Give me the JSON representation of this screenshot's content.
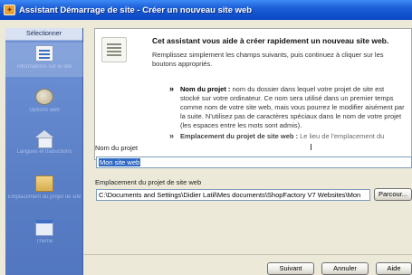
{
  "window": {
    "title": "Assistant Démarrage de site - Créer un nouveau site web"
  },
  "sidebar": {
    "header": "Sélectionner",
    "items": [
      {
        "icon": "document-icon",
        "label": "Informations sur le site"
      },
      {
        "icon": "globe-icon",
        "label": "Options web"
      },
      {
        "icon": "house-icon",
        "label": "Langues et traductions"
      },
      {
        "icon": "folder-icon",
        "label": "Emplacement du projet de site"
      },
      {
        "icon": "window-icon",
        "label": "Thème"
      }
    ]
  },
  "info": {
    "title": "Cet assistant vous aide à créer rapidement un nouveau site web.",
    "intro": "Remplissez simplement les champs suivants, puis continuez à cliquer sur les boutons appropriés.",
    "bullet1_label": "Nom du projet :",
    "bullet1_text": "nom du dossier dans lequel votre projet de site est stocké sur votre ordinateur. Ce nom sera utilisé dans un premier temps comme nom de votre site web, mais vous pourrez le modifier aisément par la suite. N'utilisez pas de caractères spéciaux dans le nom de votre projet (les espaces entre les mots sont admis).",
    "bullet2_label": "Emplacement du projet de site web :",
    "bullet2_text": "Le lieu de l'emplacement du"
  },
  "form": {
    "project_name_label": "Nom du projet",
    "project_name_value": "Mon site web",
    "location_label": "Emplacement du projet de site web",
    "location_value": "C:\\Documents and Settings\\Didier Latil\\Mes documents\\ShopFactory V7 Websites\\Mon",
    "browse_label": "Parcour..."
  },
  "footer": {
    "next_label": "Suivant",
    "cancel_label": "Annuler",
    "help_label": "Aide"
  },
  "colors": {
    "titlebar": "#0a46c4",
    "sidebar": "#5a7fc6",
    "selection": "#316ac5"
  }
}
